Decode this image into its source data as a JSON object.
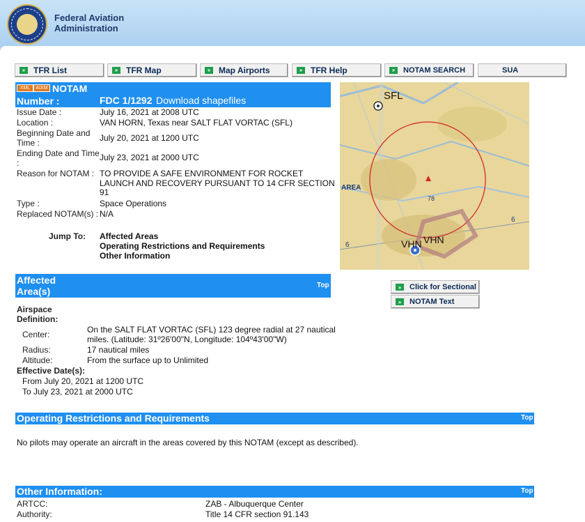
{
  "header": {
    "agency_line1": "Federal Aviation",
    "agency_line2": "Administration"
  },
  "nav": [
    {
      "label": "TFR List"
    },
    {
      "label": "TFR Map"
    },
    {
      "label": "Map Airports"
    },
    {
      "label": "TFR Help"
    },
    {
      "label": "NOTAM SEARCH"
    },
    {
      "label": "SUA"
    }
  ],
  "notam": {
    "format_badges": [
      "XML",
      "AIXM"
    ],
    "title": "NOTAM",
    "number_label": "Number :",
    "number": "FDC 1/1292",
    "download": "Download shapefiles",
    "fields": {
      "issue_date": {
        "label": "Issue Date :",
        "value": "July 16, 2021 at 2008 UTC"
      },
      "location": {
        "label": "Location :",
        "value": "VAN HORN, Texas near SALT FLAT VORTAC (SFL)"
      },
      "begin": {
        "label1": "Beginning Date and",
        "label2": "Time :",
        "value": "July 20, 2021 at 1200 UTC"
      },
      "end": {
        "label1": "Ending Date and Time",
        "label2": ":",
        "value": "July 23, 2021 at 2000 UTC"
      },
      "reason": {
        "label": "Reason for NOTAM :",
        "line1": "TO PROVIDE A SAFE ENVIRONMENT FOR ROCKET",
        "line2": "LAUNCH AND RECOVERY PURSUANT TO 14 CFR SECTION",
        "line3": "91"
      },
      "type": {
        "label": "Type :",
        "value": "Space Operations"
      },
      "replaced": {
        "label": "Replaced NOTAM(s) :",
        "value": "N/A"
      }
    },
    "jump_to": {
      "label": "Jump To:",
      "links": [
        "Affected Areas",
        "Operating Restrictions and Requirements",
        "Other Information"
      ]
    }
  },
  "map": {
    "labels": {
      "sfl": "SFL",
      "vhn1": "VHN",
      "vhn2": "VHN",
      "area": "AREA",
      "n1": "78",
      "n2": "6",
      "n3": "6"
    },
    "click_sectional": "Click for Sectional",
    "notam_text": "NOTAM Text"
  },
  "affected": {
    "title_line1": "Affected",
    "title_line2": "Area(s)",
    "top": "Top",
    "airspace_label1": "Airspace",
    "airspace_label2": "Definition:",
    "center_label": "Center:",
    "center_line1": "On the SALT FLAT VORTAC (SFL) 123 degree radial at 27 nautical",
    "center_line2": "miles. (Latitude: 31º26'00\"N, Longitude: 104º43'00\"W)",
    "radius_label": "Radius:",
    "radius": "17 nautical miles",
    "altitude_label": "Altitude:",
    "altitude": "From the surface up to Unlimited",
    "effective_label": "Effective Date(s):",
    "from": "From July 20, 2021 at 1200 UTC",
    "to": "To July 23, 2021 at 2000 UTC"
  },
  "restrictions": {
    "title": "Operating Restrictions and Requirements",
    "top": "Top",
    "text": "No pilots may operate an aircraft in the areas covered by this NOTAM (except as described)."
  },
  "other": {
    "title": "Other Information:",
    "top": "Top",
    "artcc_label": "ARTCC:",
    "artcc": "ZAB - Albuquerque Center",
    "authority_label": "Authority:",
    "authority": "Title 14 CFR section 91.143"
  },
  "colors": {
    "accent_blue": "#1f8ff0",
    "header_blue": "#a9cff0",
    "button_arrow_green": "#1e9e4b",
    "tfr_circle_red": "#d22828"
  }
}
